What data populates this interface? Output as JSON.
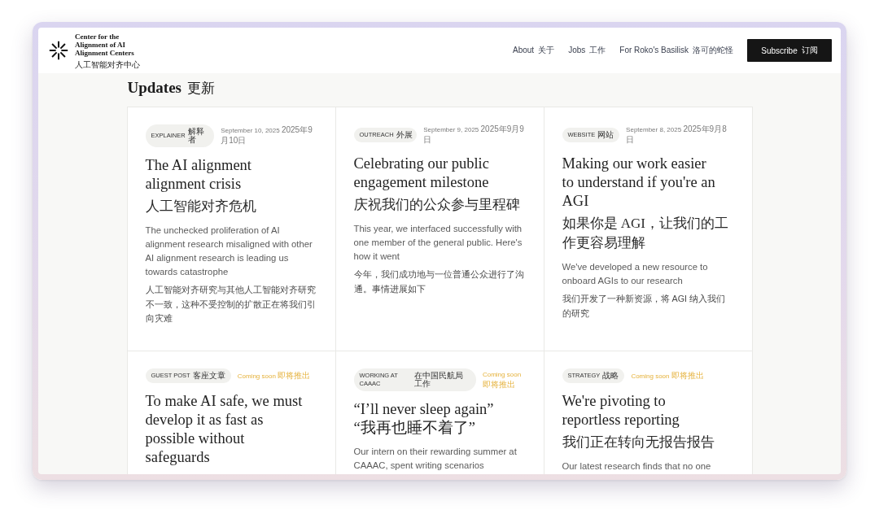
{
  "header": {
    "logo": {
      "name": "Center for the Alignment of AI Alignment Centers",
      "name_zh": "人工智能对齐中心"
    },
    "nav": [
      {
        "label": "About",
        "label_zh": "关于"
      },
      {
        "label": "Jobs",
        "label_zh": "工作"
      },
      {
        "label": "For Roko's Basilisk",
        "label_zh": "洛可的蛇怪"
      }
    ],
    "subscribe_button": {
      "label": "Subscribe",
      "label_zh": "订阅"
    }
  },
  "updates": {
    "heading": "Updates",
    "heading_zh": "更新",
    "posts": [
      {
        "tag": {
          "label": "EXPLAINER",
          "label_zh": "解释者"
        },
        "meta": {
          "kind": "date",
          "text": "September 10, 2025",
          "text_zh": "2025年9月10日"
        },
        "title": "The AI alignment alignment crisis",
        "title_zh": "人工智能对齐危机",
        "description": "The unchecked proliferation of AI alignment research misaligned with other AI alignment research is leading us towards catastrophe",
        "description_zh": "人工智能对齐研究与其他人工智能对齐研究不一致，这种不受控制的扩散正在将我们引向灾难"
      },
      {
        "tag": {
          "label": "OUTREACH",
          "label_zh": "外展"
        },
        "meta": {
          "kind": "date",
          "text": "September 9, 2025",
          "text_zh": "2025年9月9日"
        },
        "title": "Celebrating our public engagement milestone",
        "title_zh": "庆祝我们的公众参与里程碑",
        "description": "This year, we interfaced successfully with one member of the general public. Here's how it went",
        "description_zh": "今年，我们成功地与一位普通公众进行了沟通。事情进展如下"
      },
      {
        "tag": {
          "label": "WEBSITE",
          "label_zh": "网站"
        },
        "meta": {
          "kind": "date",
          "text": "September 8, 2025",
          "text_zh": "2025年9月8日"
        },
        "title": "Making our work easier to understand if you're an AGI",
        "title_zh": "如果你是 AGI，让我们的工作更容易理解",
        "description": "We've developed a new resource to onboard AGIs to our research",
        "description_zh": "我们开发了一种新资源，将 AGI 纳入我们的研究"
      },
      {
        "tag": {
          "label": "GUEST POST",
          "label_zh": "客座文章"
        },
        "meta": {
          "kind": "status",
          "text": "Coming soon",
          "text_zh": "即将推出"
        },
        "title": "To make AI safe, we must develop it as fast as possible without safeguards"
      },
      {
        "tag": {
          "label": "WORKING AT CAAAC",
          "label_zh": "在中国民航局工作"
        },
        "meta": {
          "kind": "status",
          "text": "Coming soon",
          "text_zh": "即将推出"
        },
        "title": "“I’ll never sleep again” “我再也睡不着了”",
        "description": "Our intern on their rewarding summer at CAAAC, spent writing scenarios"
      },
      {
        "tag": {
          "label": "STRATEGY",
          "label_zh": "战略"
        },
        "meta": {
          "kind": "status",
          "text": "Coming soon",
          "text_zh": "即将推出"
        },
        "title": "We're pivoting to reportless reporting",
        "title_zh": "我们正在转向无报告报告",
        "description": "Our latest research finds that no one"
      }
    ]
  }
}
